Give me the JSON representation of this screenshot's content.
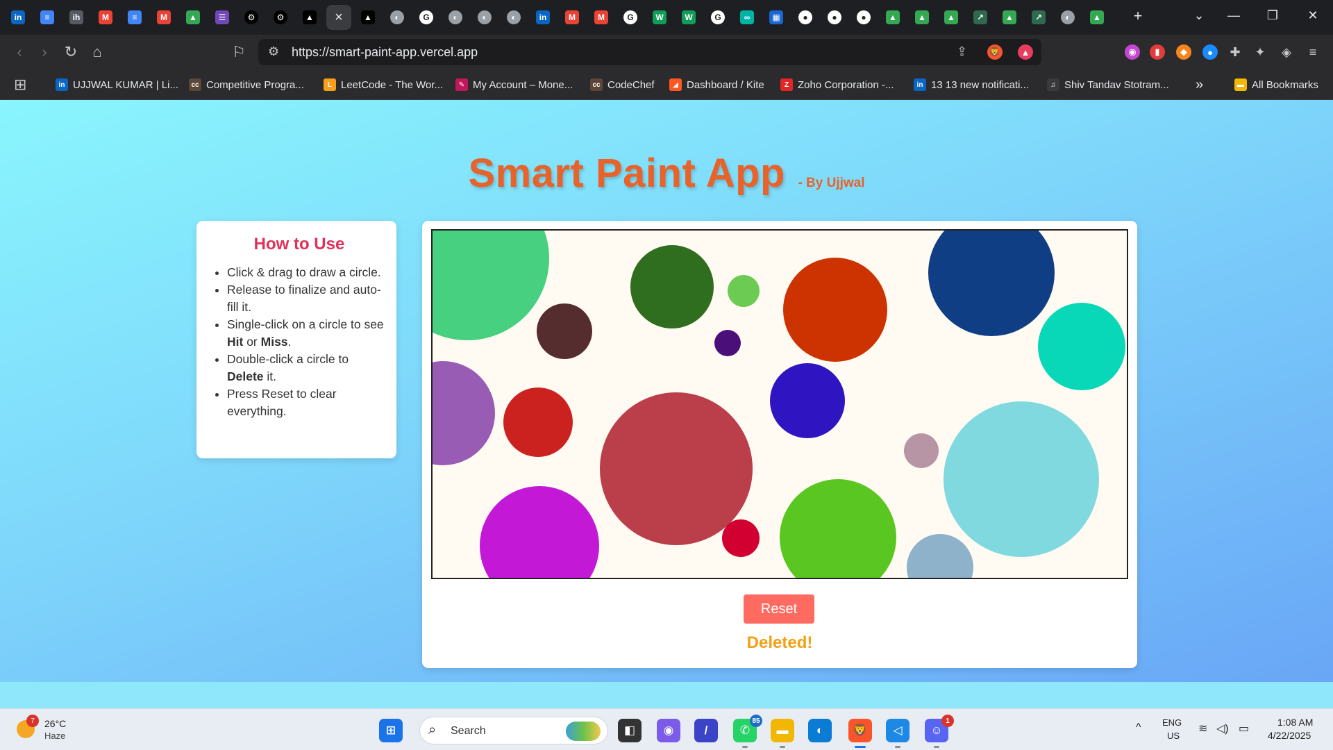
{
  "tabs": {
    "items": [
      {
        "icon": "linkedin-icon",
        "glyph": "in",
        "color": "#0a66c2"
      },
      {
        "icon": "docs-icon",
        "glyph": "≡",
        "color": "#4285f4"
      },
      {
        "icon": "internshala-icon",
        "glyph": "ih",
        "color": "#555a63"
      },
      {
        "icon": "gmail-icon",
        "glyph": "M",
        "color": "#ea4335"
      },
      {
        "icon": "docs-icon",
        "glyph": "≡",
        "color": "#4285f4"
      },
      {
        "icon": "gmail-icon",
        "glyph": "M",
        "color": "#ea4335"
      },
      {
        "icon": "drive-icon",
        "glyph": "▲",
        "color": "#34a853"
      },
      {
        "icon": "forms-icon",
        "glyph": "☰",
        "color": "#7248b9"
      },
      {
        "icon": "openai-icon",
        "glyph": "⚙",
        "color": "#000000"
      },
      {
        "icon": "openai-icon",
        "glyph": "⚙",
        "color": "#000000"
      },
      {
        "icon": "vercel-icon",
        "glyph": "▲",
        "color": "#000000"
      },
      {
        "icon": "close-icon",
        "glyph": "×",
        "color": "#3b3c40"
      },
      {
        "icon": "vercel-icon",
        "glyph": "▲",
        "color": "#000000"
      },
      {
        "icon": "globe-icon",
        "glyph": "◐",
        "color": "#9aa0a6"
      },
      {
        "icon": "google-icon",
        "glyph": "G",
        "color": "#ffffff"
      },
      {
        "icon": "globe-icon",
        "glyph": "◐",
        "color": "#9aa0a6"
      },
      {
        "icon": "globe-icon",
        "glyph": "◐",
        "color": "#9aa0a6"
      },
      {
        "icon": "globe-icon",
        "glyph": "◐",
        "color": "#9aa0a6"
      },
      {
        "icon": "linkedin-icon",
        "glyph": "in",
        "color": "#0a66c2"
      },
      {
        "icon": "gmail-icon",
        "glyph": "M",
        "color": "#ea4335"
      },
      {
        "icon": "gmail-icon",
        "glyph": "M",
        "color": "#ea4335"
      },
      {
        "icon": "google-icon",
        "glyph": "G",
        "color": "#ffffff"
      },
      {
        "icon": "w-icon",
        "glyph": "W",
        "color": "#0f9d58"
      },
      {
        "icon": "w-icon",
        "glyph": "W",
        "color": "#0f9d58"
      },
      {
        "icon": "google-icon",
        "glyph": "G",
        "color": "#ffffff"
      },
      {
        "icon": "link-icon",
        "glyph": "∞",
        "color": "#00b3a7"
      },
      {
        "icon": "calendar-icon",
        "glyph": "▦",
        "color": "#1967d2"
      },
      {
        "icon": "github-icon",
        "glyph": "●",
        "color": "#ffffff"
      },
      {
        "icon": "github-icon",
        "glyph": "●",
        "color": "#ffffff"
      },
      {
        "icon": "github-icon",
        "glyph": "●",
        "color": "#ffffff"
      },
      {
        "icon": "drive-icon",
        "glyph": "▲",
        "color": "#34a853"
      },
      {
        "icon": "drive-icon",
        "glyph": "▲",
        "color": "#34a853"
      },
      {
        "icon": "drive-icon",
        "glyph": "▲",
        "color": "#34a853"
      },
      {
        "icon": "app-icon",
        "glyph": "↗",
        "color": "#2d6a4f"
      },
      {
        "icon": "drive-icon",
        "glyph": "▲",
        "color": "#34a853"
      },
      {
        "icon": "app-icon",
        "glyph": "↗",
        "color": "#2d6a4f"
      },
      {
        "icon": "globe-icon",
        "glyph": "◐",
        "color": "#9aa0a6"
      },
      {
        "icon": "drive-icon",
        "glyph": "▲",
        "color": "#34a853"
      }
    ],
    "new_tab_glyph": "+",
    "tab_search_glyph": "⌄"
  },
  "window_controls": {
    "minimize": "—",
    "restore": "❐",
    "close": "✕"
  },
  "nav": {
    "back": "‹",
    "forward": "›",
    "reload": "↻",
    "home": "⌂",
    "bookmark": "⚐"
  },
  "address_bar": {
    "url": "https://smart-paint-app.vercel.app",
    "site_info_glyph": "⚙",
    "share_glyph": "⇪"
  },
  "extensions": [
    {
      "icon": "brave-shield-icon",
      "glyph": "🦁",
      "color": "#fb542b"
    },
    {
      "icon": "brave-rewards-icon",
      "glyph": "▲",
      "color": "#e83d5d"
    },
    {
      "icon": "extension-icon",
      "glyph": "◉",
      "color": "#c447d1"
    },
    {
      "icon": "audio-icon",
      "glyph": "▮",
      "color": "#e13b3b"
    },
    {
      "icon": "metamask-icon",
      "glyph": "◆",
      "color": "#f6851b"
    },
    {
      "icon": "dot-icon",
      "glyph": "●",
      "color": "#1a8cff"
    },
    {
      "icon": "puzzle-icon",
      "glyph": "✚",
      "color": "#5f6368"
    },
    {
      "icon": "leo-icon",
      "glyph": "✦",
      "color": "#5f6368"
    },
    {
      "icon": "vpn-icon",
      "glyph": "◈",
      "color": "#5f6368"
    },
    {
      "icon": "menu-icon",
      "glyph": "≡",
      "color": "#5f6368"
    }
  ],
  "bookmarks": {
    "apps_glyph": "⊞",
    "items": [
      {
        "label": "UJJWAL KUMAR | Li...",
        "icon": "linkedin-icon",
        "glyph": "in",
        "color": "#0a66c2"
      },
      {
        "label": "Competitive Progra...",
        "icon": "codechef-icon",
        "glyph": "cc",
        "color": "#5b4638"
      },
      {
        "label": "LeetCode - The Wor...",
        "icon": "leetcode-icon",
        "glyph": "L",
        "color": "#f89f1b"
      },
      {
        "label": "My Account – Mone...",
        "icon": "moneycontrol-icon",
        "glyph": "✎",
        "color": "#c2185b"
      },
      {
        "label": "CodeChef",
        "icon": "codechef-icon",
        "glyph": "cc",
        "color": "#5b4638"
      },
      {
        "label": "Dashboard / Kite",
        "icon": "kite-icon",
        "glyph": "◢",
        "color": "#ff5722"
      },
      {
        "label": "Zoho Corporation -...",
        "icon": "zoho-icon",
        "glyph": "Z",
        "color": "#e42527"
      },
      {
        "label": "13 13 new notificati...",
        "icon": "linkedin-icon",
        "glyph": "in",
        "color": "#0a66c2"
      },
      {
        "label": "Shiv Tandav Stotram...",
        "icon": "music-icon",
        "glyph": "♫",
        "color": "#3a3a3d"
      }
    ],
    "more_glyph": "»",
    "all_bookmarks": "All Bookmarks"
  },
  "page": {
    "title": "Smart Paint App",
    "byline": "- By Ujjwal",
    "howto": {
      "heading": "How to Use",
      "items": [
        {
          "pre": "Click & drag to draw a circle."
        },
        {
          "pre": "Release to finalize and auto-fill it."
        },
        {
          "pre": "Single-click on a circle to see ",
          "b1": "Hit",
          "mid": " or ",
          "b2": "Miss",
          "post": "."
        },
        {
          "pre": "Double-click a circle to ",
          "b1": "Delete",
          "post": " it."
        },
        {
          "pre": "Press Reset to clear everything."
        }
      ]
    },
    "reset_label": "Reset",
    "status": "Deleted!",
    "circle_colors": [
      "#47d07f",
      "#552d2e",
      "#2f6e1e",
      "#6ccb52",
      "#4b0f7a",
      "#cc3300",
      "#0f3e84",
      "#08d8b8",
      "#995cb5",
      "#cc221f",
      "#bb3f4a",
      "#2f14c2",
      "#b895a5",
      "#80d9de",
      "#c318d6",
      "#d10031",
      "#5ac622",
      "#8eb2c9"
    ]
  },
  "taskbar": {
    "weather": {
      "temp": "26°C",
      "condition": "Haze",
      "badge": "7"
    },
    "search_placeholder": "Search",
    "apps": [
      {
        "icon": "windows-start-icon",
        "glyph": "⊞",
        "color": "#1a73e8"
      },
      {
        "icon": "task-view-icon",
        "glyph": "◧",
        "color": "#333333"
      },
      {
        "icon": "copilot-icon",
        "glyph": "◉",
        "color": "#7b5be8"
      },
      {
        "icon": "editor-icon",
        "glyph": "/",
        "color": "#3b43c8"
      },
      {
        "icon": "whatsapp-icon",
        "glyph": "✆",
        "color": "#25d366",
        "badge": "85"
      },
      {
        "icon": "file-explorer-icon",
        "glyph": "▬",
        "color": "#f2b705"
      },
      {
        "icon": "edge-icon",
        "glyph": "◐",
        "color": "#0b7cd4"
      },
      {
        "icon": "brave-icon",
        "glyph": "🦁",
        "color": "#fb542b"
      },
      {
        "icon": "vscode-icon",
        "glyph": "◁",
        "color": "#1e88e5"
      },
      {
        "icon": "discord-icon",
        "glyph": "☺",
        "color": "#5865f2",
        "badge": "1"
      }
    ],
    "tray": {
      "chevron": "^",
      "lang1": "ENG",
      "lang2": "US",
      "time": "1:08 AM",
      "date": "4/22/2025"
    }
  }
}
